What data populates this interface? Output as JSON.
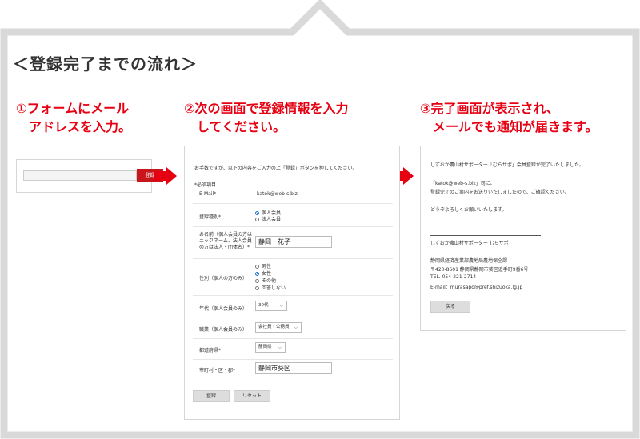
{
  "heading": "＜登録完了までの流れ＞",
  "steps": [
    {
      "line1": "①フォームにメール",
      "line2": "アドレスを入力。"
    },
    {
      "line1": "②次の画面で登録情報を入力",
      "line2": "してください。"
    },
    {
      "line1": "③完了画面が表示され、",
      "line2": "メールでも通知が届きます。"
    }
  ],
  "step1_form": {
    "register_button": "登録"
  },
  "step2_form": {
    "intro": "お手数ですが、以下の内容をご入力の上「登録」ボタンを押してください。",
    "required_note": "*必須項目",
    "email_label": "E-Mail*",
    "email_value": "katok@web-s.biz",
    "type_label": "登録種別*",
    "type_options": [
      "個人会員",
      "法人会員"
    ],
    "name_label": "お名前（個人会員の方は\nニックネーム、法人会員\nの方は法人・団体名）*",
    "name_value": "静岡　花子",
    "gender_label": "性別（個人の方のみ）",
    "gender_options": [
      "男性",
      "女性",
      "その他",
      "回答しない"
    ],
    "age_label": "年代（個人会員のみ）",
    "age_value": "30代",
    "job_label": "職業（個人会員のみ）",
    "job_value": "会社員・公務員",
    "pref_label": "都道府県*",
    "pref_value": "静岡県",
    "city_label": "市町村・区・郡*",
    "city_value": "静岡市葵区",
    "submit_label": "登録",
    "reset_label": "リセット"
  },
  "step3_mail": {
    "line1": "しずおか農山村サポーター「むらサポ」会員登録が完了いたしました。",
    "line2": "「katok@web-s.biz」司に、",
    "line3": "登録完了のご案内をお送りいたしましたので、ご確認ください。",
    "line4": "どうぞよろしくお願いいたします。",
    "sig1": "しずおか農山村サポーター むらサポ",
    "sig2": "静岡県経済産業部農地局農地保全課",
    "sig3": "〒420-8601 静岡県静岡市葵区追手町9番6号",
    "sig4": "TEL. 054-221-2714",
    "sig5": "E-mail：murasapo@pref.shizuoka.lg.jp",
    "back_label": "戻る"
  },
  "colors": {
    "accent": "#e60012",
    "button_red": "#c8161d",
    "frame": "#d9d9d9"
  },
  "icons": [
    "right-arrow-icon",
    "radio-icon",
    "chevron-down-icon"
  ]
}
